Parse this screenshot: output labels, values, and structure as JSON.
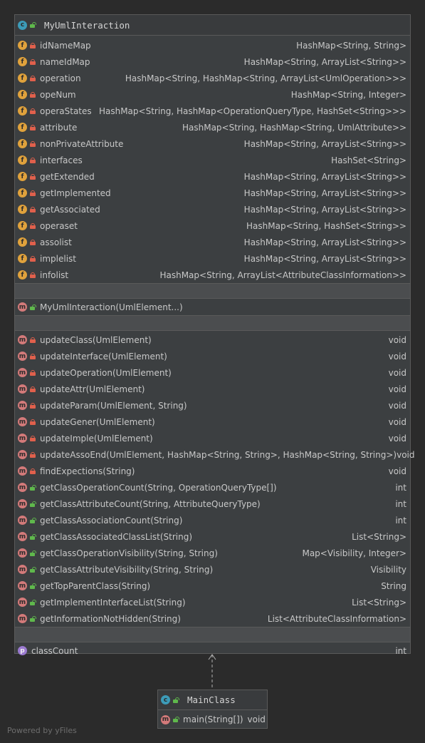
{
  "main_class": {
    "name": "MyUmlInteraction",
    "fields": [
      {
        "name": "idNameMap",
        "type": "HashMap<String, String>"
      },
      {
        "name": "nameIdMap",
        "type": "HashMap<String, ArrayList<String>>"
      },
      {
        "name": "operation",
        "type": "HashMap<String, HashMap<String, ArrayList<UmlOperation>>>"
      },
      {
        "name": "opeNum",
        "type": "HashMap<String, Integer>"
      },
      {
        "name": "operaStates",
        "type": "HashMap<String, HashMap<OperationQueryType, HashSet<String>>>"
      },
      {
        "name": "attribute",
        "type": "HashMap<String, HashMap<String, UmlAttribute>>"
      },
      {
        "name": "nonPrivateAttribute",
        "type": "HashMap<String, ArrayList<String>>"
      },
      {
        "name": "interfaces",
        "type": "HashSet<String>"
      },
      {
        "name": "getExtended",
        "type": "HashMap<String, ArrayList<String>>"
      },
      {
        "name": "getImplemented",
        "type": "HashMap<String, ArrayList<String>>"
      },
      {
        "name": "getAssociated",
        "type": "HashMap<String, ArrayList<String>>"
      },
      {
        "name": "operaset",
        "type": "HashMap<String, HashSet<String>>"
      },
      {
        "name": "assolist",
        "type": "HashMap<String, ArrayList<String>>"
      },
      {
        "name": "implelist",
        "type": "HashMap<String, ArrayList<String>>"
      },
      {
        "name": "infolist",
        "type": "HashMap<String, ArrayList<AttributeClassInformation>>"
      }
    ],
    "constructor": "MyUmlInteraction(UmlElement...)",
    "methods": [
      {
        "name": "updateClass(UmlElement)",
        "type": "void",
        "visibility": "private"
      },
      {
        "name": "updateInterface(UmlElement)",
        "type": "void",
        "visibility": "private"
      },
      {
        "name": "updateOperation(UmlElement)",
        "type": "void",
        "visibility": "private"
      },
      {
        "name": "updateAttr(UmlElement)",
        "type": "void",
        "visibility": "private"
      },
      {
        "name": "updateParam(UmlElement, String)",
        "type": "void",
        "visibility": "private"
      },
      {
        "name": "updateGener(UmlElement)",
        "type": "void",
        "visibility": "private"
      },
      {
        "name": "updateImple(UmlElement)",
        "type": "void",
        "visibility": "private"
      },
      {
        "name": "updateAssoEnd(UmlElement, HashMap<String, String>, HashMap<String, String>)",
        "type": "void",
        "visibility": "private"
      },
      {
        "name": "findExpections(String)",
        "type": "void",
        "visibility": "private"
      },
      {
        "name": "getClassOperationCount(String, OperationQueryType[])",
        "type": "int",
        "visibility": "public"
      },
      {
        "name": "getClassAttributeCount(String, AttributeQueryType)",
        "type": "int",
        "visibility": "public"
      },
      {
        "name": "getClassAssociationCount(String)",
        "type": "int",
        "visibility": "public"
      },
      {
        "name": "getClassAssociatedClassList(String)",
        "type": "List<String>",
        "visibility": "public"
      },
      {
        "name": "getClassOperationVisibility(String, String)",
        "type": "Map<Visibility, Integer>",
        "visibility": "public"
      },
      {
        "name": "getClassAttributeVisibility(String, String)",
        "type": "Visibility",
        "visibility": "public"
      },
      {
        "name": "getTopParentClass(String)",
        "type": "String",
        "visibility": "public"
      },
      {
        "name": "getImplementInterfaceList(String)",
        "type": "List<String>",
        "visibility": "public"
      },
      {
        "name": "getInformationNotHidden(String)",
        "type": "List<AttributeClassInformation>",
        "visibility": "public"
      }
    ],
    "property": {
      "name": "classCount",
      "type": "int"
    }
  },
  "second_class": {
    "name": "MainClass",
    "method": "main(String[])",
    "method_type": "void"
  },
  "footer": "Powered by yFiles",
  "icon_letters": {
    "class": "c",
    "field": "f",
    "method": "m",
    "property": "p"
  },
  "colors": {
    "background": "#2b2b2b",
    "field_icon": "#e0a23c",
    "method_icon": "#d37a7a",
    "class_icon": "#3c9bb8",
    "property_icon": "#9b7ad0",
    "private_lock": "#e0604c",
    "public_lock": "#5fb84c"
  }
}
